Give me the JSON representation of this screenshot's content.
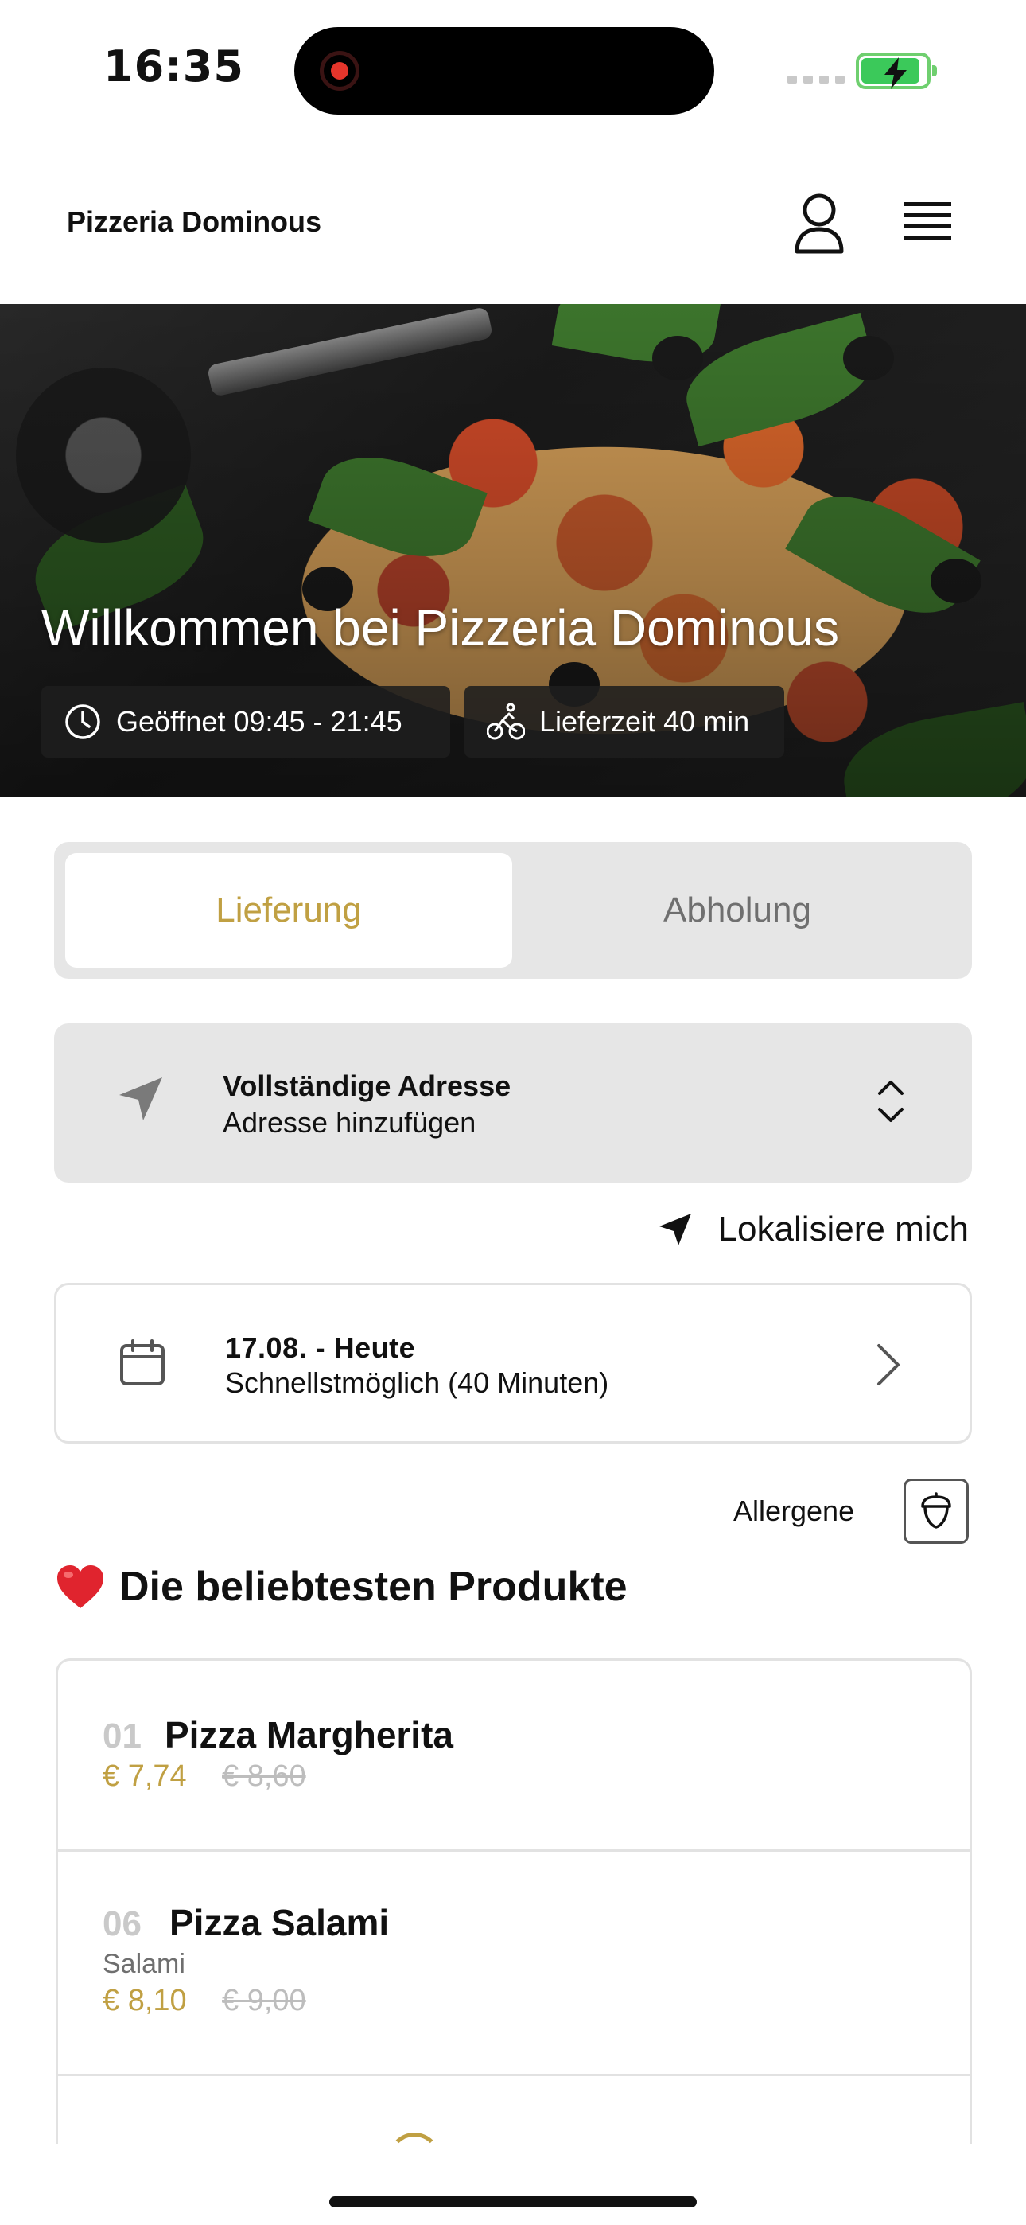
{
  "status_bar": {
    "time": "16:35"
  },
  "header": {
    "brand": "Pizzeria Dominous"
  },
  "hero": {
    "title": "Willkommen bei Pizzeria Dominous",
    "opening_hours": "Geöffnet 09:45 - 21:45",
    "delivery_time": "Lieferzeit 40 min"
  },
  "mode": {
    "delivery": "Lieferung",
    "pickup": "Abholung",
    "selected": "delivery"
  },
  "address": {
    "title": "Vollständige Adresse",
    "subtitle": "Adresse hinzufügen"
  },
  "locate_me": "Lokalisiere mich",
  "schedule": {
    "title": "17.08. - Heute",
    "subtitle": "Schnellstmöglich (40 Minuten)"
  },
  "allergens_label": "Allergene",
  "popular": {
    "emoji": "❤️",
    "title": "Die beliebtesten Produkte",
    "products": [
      {
        "number": "01",
        "name": "Pizza Margherita",
        "description": "",
        "price": "€ 7,74",
        "old_price": "€ 8,60"
      },
      {
        "number": "06",
        "name": "Pizza Salami",
        "description": "Salami",
        "price": "€ 8,10",
        "old_price": "€ 9,00"
      }
    ]
  },
  "colors": {
    "accent": "#c0a043",
    "card_bg": "#e6e6e6",
    "muted": "#6f6f6f"
  }
}
